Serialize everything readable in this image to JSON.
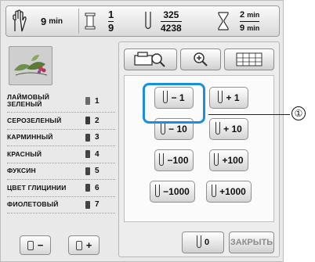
{
  "status_bar": {
    "total_time": "9",
    "total_time_unit": "min",
    "color_current": "1",
    "color_total": "9",
    "stitch_current": "325",
    "stitch_total": "4238",
    "time_elapsed": "2",
    "time_elapsed_unit": "min",
    "time_total": "9",
    "time_total_unit": "min"
  },
  "thread_list": [
    {
      "name": "ЛАЙМОВЫЙ ЗЕЛЕНЫЙ",
      "num": "1"
    },
    {
      "name": "СЕРОЗЕЛЕНЫЙ",
      "num": "2"
    },
    {
      "name": "КАРМИННЫЙ",
      "num": "3"
    },
    {
      "name": "КРАСНЫЙ",
      "num": "4"
    },
    {
      "name": "ФУКСИН",
      "num": "5"
    },
    {
      "name": "ЦВЕТ ГЛИЦИНИИ",
      "num": "6"
    },
    {
      "name": "ФИОЛЕТОВЫЙ",
      "num": "7"
    }
  ],
  "left_buttons": {
    "minus": "−",
    "plus": "+"
  },
  "stitch_buttons": {
    "minus_1": "− 1",
    "plus_1": "+ 1",
    "minus_10": "− 10",
    "plus_10": "+ 10",
    "minus_100": "−100",
    "plus_100": "+100",
    "minus_1000": "−1000",
    "plus_1000": "+1000"
  },
  "zero_button": "0",
  "close_button": "ЗАКРЫТЬ",
  "callout_label": "①",
  "colors": {
    "highlight": "#1a8fe0"
  }
}
